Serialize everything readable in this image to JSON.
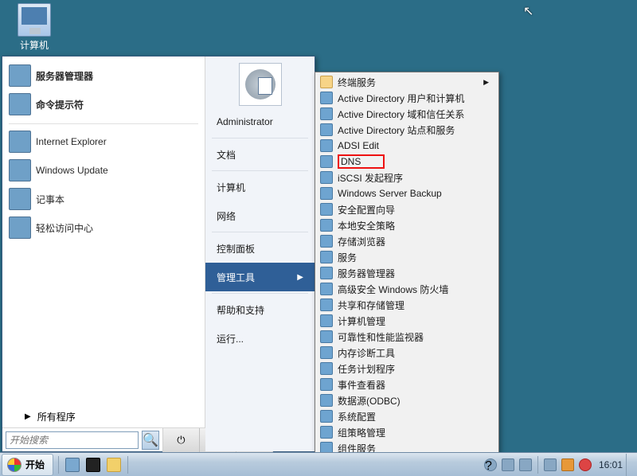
{
  "desktop": {
    "computer_label": "计算机"
  },
  "start_menu": {
    "pinned": [
      {
        "label": "服务器管理器",
        "bold": true
      },
      {
        "label": "命令提示符",
        "bold": true
      }
    ],
    "recent": [
      {
        "label": "Internet Explorer"
      },
      {
        "label": "Windows Update"
      },
      {
        "label": "记事本"
      },
      {
        "label": "轻松访问中心"
      }
    ],
    "all_programs": "所有程序",
    "search_placeholder": "开始搜索",
    "right": {
      "user": "Administrator",
      "items": [
        {
          "label": "文档"
        },
        {
          "label": "计算机"
        },
        {
          "label": "网络"
        },
        {
          "label": "控制面板"
        },
        {
          "label": "管理工具",
          "selected": true,
          "has_sub": true
        },
        {
          "label": "帮助和支持"
        },
        {
          "label": "运行..."
        }
      ]
    }
  },
  "submenu": {
    "items": [
      {
        "label": "终端服务",
        "folder": true,
        "has_sub": true
      },
      {
        "label": "Active Directory 用户和计算机"
      },
      {
        "label": "Active Directory 域和信任关系"
      },
      {
        "label": "Active Directory 站点和服务"
      },
      {
        "label": "ADSI Edit"
      },
      {
        "label": "DNS",
        "boxed": true
      },
      {
        "label": "iSCSI 发起程序"
      },
      {
        "label": "Windows Server Backup"
      },
      {
        "label": "安全配置向导"
      },
      {
        "label": "本地安全策略"
      },
      {
        "label": "存储浏览器"
      },
      {
        "label": "服务"
      },
      {
        "label": "服务器管理器"
      },
      {
        "label": "高级安全 Windows 防火墙"
      },
      {
        "label": "共享和存储管理"
      },
      {
        "label": "计算机管理"
      },
      {
        "label": "可靠性和性能监视器"
      },
      {
        "label": "内存诊断工具"
      },
      {
        "label": "任务计划程序"
      },
      {
        "label": "事件查看器"
      },
      {
        "label": "数据源(ODBC)"
      },
      {
        "label": "系统配置"
      },
      {
        "label": "组策略管理"
      },
      {
        "label": "组件服务"
      }
    ]
  },
  "taskbar": {
    "start": "开始",
    "clock": "16:01"
  }
}
